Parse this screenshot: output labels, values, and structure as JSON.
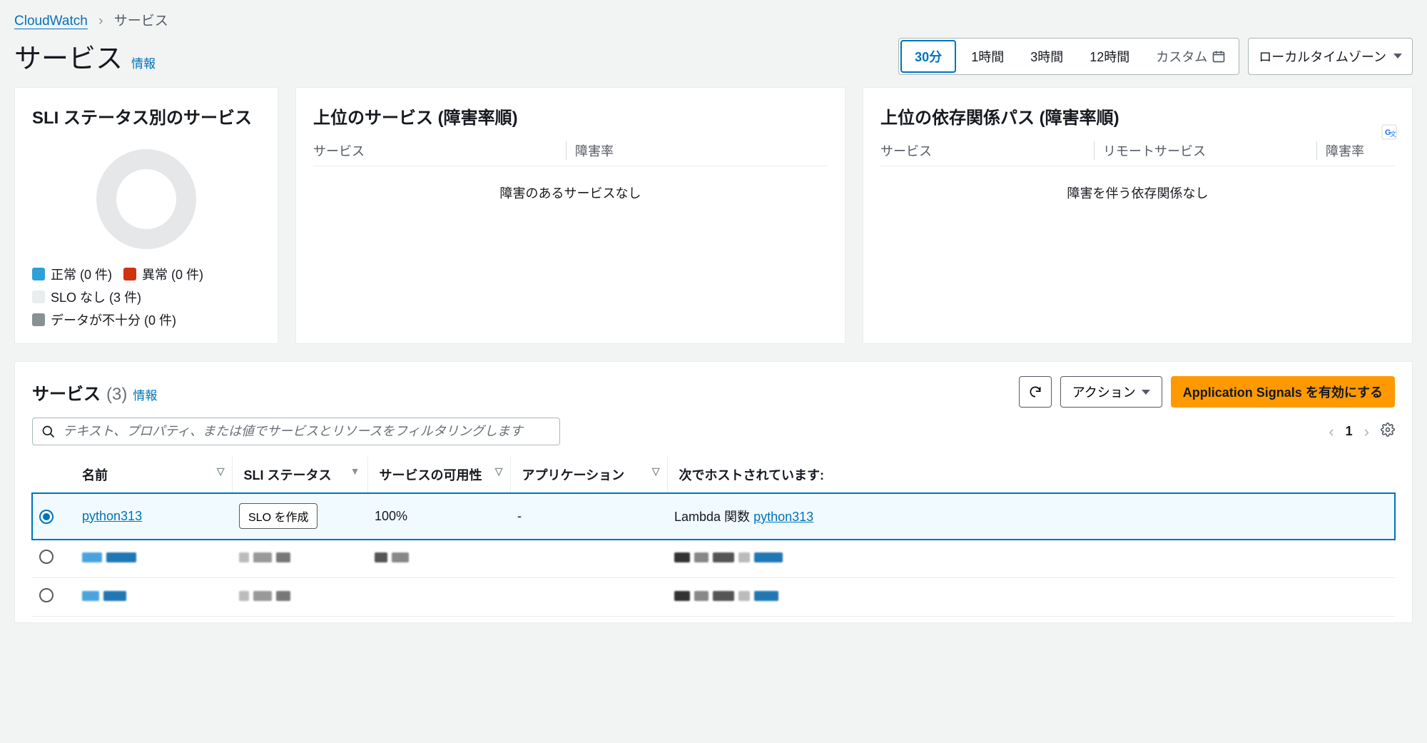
{
  "breadcrumb": {
    "root": "CloudWatch",
    "current": "サービス"
  },
  "page": {
    "title": "サービス",
    "info_link": "情報"
  },
  "time_range": {
    "options": [
      "30分",
      "1時間",
      "3時間",
      "12時間"
    ],
    "active": "30分",
    "custom_label": "カスタム"
  },
  "timezone": {
    "label": "ローカルタイムゾーン"
  },
  "cards": {
    "sli_status": {
      "title": "SLI ステータス別のサービス",
      "legend": [
        {
          "label": "正常 (0 件)",
          "swatch": "sw-blue"
        },
        {
          "label": "異常 (0 件)",
          "swatch": "sw-red"
        },
        {
          "label": "SLO なし (3 件)",
          "swatch": "sw-grey-l"
        },
        {
          "label": "データが不十分 (0 件)",
          "swatch": "sw-grey-d"
        }
      ]
    },
    "top_services": {
      "title": "上位のサービス (障害率順)",
      "columns": [
        "サービス",
        "障害率"
      ],
      "empty": "障害のあるサービスなし"
    },
    "top_deps": {
      "title": "上位の依存関係パス (障害率順)",
      "columns": [
        "サービス",
        "リモートサービス",
        "障害率"
      ],
      "empty": "障害を伴う依存関係なし"
    }
  },
  "services_panel": {
    "title": "サービス",
    "count": "(3)",
    "info_link": "情報",
    "actions_label": "アクション",
    "enable_label": "Application Signals を有効にする",
    "search_placeholder": "テキスト、プロパティ、または値でサービスとリソースをフィルタリングします",
    "page_number": "1",
    "columns": {
      "name": "名前",
      "sli": "SLI ステータス",
      "availability": "サービスの可用性",
      "application": "アプリケーション",
      "hosted": "次でホストされています:"
    },
    "rows": [
      {
        "selected": true,
        "name": "python313",
        "sli_action": "SLO を作成",
        "availability": "100%",
        "application": "-",
        "hosted_prefix": "Lambda 関数 ",
        "hosted_link": "python313",
        "redacted": false
      },
      {
        "selected": false,
        "redacted": true
      },
      {
        "selected": false,
        "redacted": true
      }
    ]
  },
  "chart_data": {
    "type": "pie",
    "title": "SLI ステータス別のサービス",
    "series": [
      {
        "name": "正常",
        "value": 0,
        "color": "#2ea0d9"
      },
      {
        "name": "異常",
        "value": 0,
        "color": "#d13212"
      },
      {
        "name": "SLO なし",
        "value": 3,
        "color": "#eaeded"
      },
      {
        "name": "データが不十分",
        "value": 0,
        "color": "#879196"
      }
    ]
  }
}
